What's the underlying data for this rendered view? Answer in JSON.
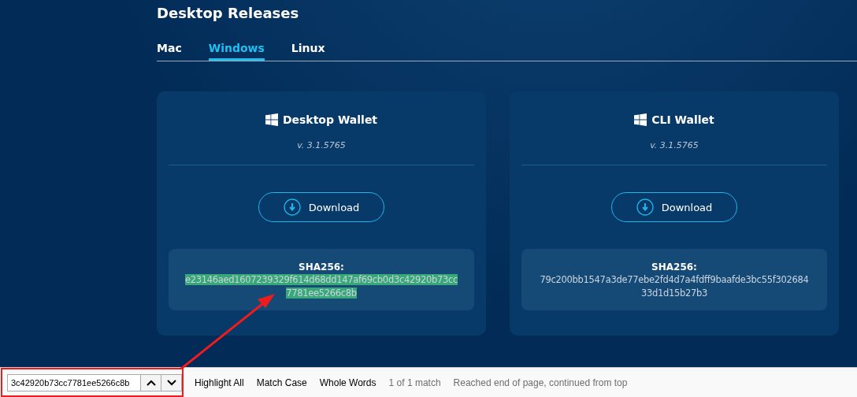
{
  "page": {
    "title": "Desktop Releases"
  },
  "tabs": [
    {
      "label": "Mac",
      "selected": false
    },
    {
      "label": "Windows",
      "selected": true
    },
    {
      "label": "Linux",
      "selected": false
    }
  ],
  "cards": [
    {
      "title": "Desktop Wallet",
      "version": "v. 3.1.5765",
      "button": "Download",
      "hash_label": "SHA256:",
      "hash_lines": [
        "e23146aed1607239329f614d68dd147af69cb0d3c42920b73cc",
        "7781ee5266c8b"
      ],
      "highlighted": true
    },
    {
      "title": "CLI Wallet",
      "version": "v. 3.1.5765",
      "button": "Download",
      "hash_label": "SHA256:",
      "hash_lines": [
        "79c200bb1547a3de77ebe2fd4d7a4fdff9baafde3bc55f302684",
        "33d1d15b27b3"
      ],
      "highlighted": false
    }
  ],
  "find_bar": {
    "value": "3c42920b73cc7781ee5266c8b",
    "options": [
      {
        "label": "Highlight All"
      },
      {
        "label": "Match Case"
      },
      {
        "label": "Whole Words"
      }
    ],
    "match_count": "1 of 1 match",
    "status": "Reached end of page, continued from top"
  },
  "annotation": {
    "highlight_box": true,
    "arrow": true
  }
}
